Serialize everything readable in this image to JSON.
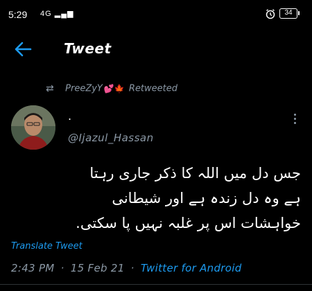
{
  "status_bar": {
    "time": "5:29",
    "network": "4G",
    "battery": "34"
  },
  "header": {
    "title": "Tweet"
  },
  "retweet": {
    "name": "PreeZyY",
    "emojis": "💕🍁",
    "label": "Retweeted"
  },
  "tweet": {
    "author_name": ".",
    "handle": "@Ijazul_Hassan",
    "text_lines": [
      "جس دل میں اللہ کا ذکر جاری رہتا",
      "ہے وہ دل زندہ ہے اور شیطانی",
      "خواہشات اس پر غلبہ نہیں پا سکتی."
    ],
    "translate_label": "Translate Tweet",
    "time": "2:43 PM",
    "separator": "·",
    "date": "15 Feb 21",
    "source": "Twitter for Android"
  },
  "colors": {
    "background": "#000000",
    "link": "#1d9bf0",
    "secondary": "#8b98a5"
  },
  "icons": {
    "back": "arrow-left-icon",
    "retweet": "retweet-icon",
    "more": "more-vertical-icon",
    "alarm": "alarm-icon",
    "signal": "signal-icon",
    "battery": "battery-icon"
  }
}
